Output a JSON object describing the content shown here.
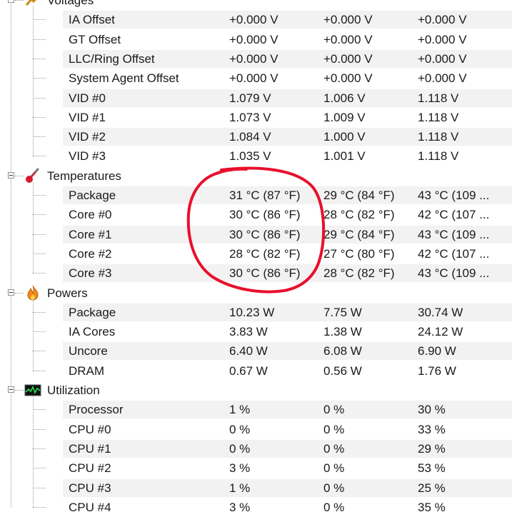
{
  "categories": [
    {
      "key": "voltages",
      "label": "Voltages",
      "icon": "voltage-icon",
      "rows": [
        {
          "name": "IA Offset",
          "v1": "+0.000 V",
          "v2": "+0.000 V",
          "v3": "+0.000 V"
        },
        {
          "name": "GT Offset",
          "v1": "+0.000 V",
          "v2": "+0.000 V",
          "v3": "+0.000 V"
        },
        {
          "name": "LLC/Ring Offset",
          "v1": "+0.000 V",
          "v2": "+0.000 V",
          "v3": "+0.000 V"
        },
        {
          "name": "System Agent Offset",
          "v1": "+0.000 V",
          "v2": "+0.000 V",
          "v3": "+0.000 V"
        },
        {
          "name": "VID #0",
          "v1": "1.079 V",
          "v2": "1.006 V",
          "v3": "1.118 V"
        },
        {
          "name": "VID #1",
          "v1": "1.073 V",
          "v2": "1.009 V",
          "v3": "1.118 V"
        },
        {
          "name": "VID #2",
          "v1": "1.084 V",
          "v2": "1.000 V",
          "v3": "1.118 V"
        },
        {
          "name": "VID #3",
          "v1": "1.035 V",
          "v2": "1.001 V",
          "v3": "1.118 V"
        }
      ]
    },
    {
      "key": "temperatures",
      "label": "Temperatures",
      "icon": "thermometer-icon",
      "rows": [
        {
          "name": "Package",
          "v1": "31 °C  (87 °F)",
          "v2": "29 °C  (84 °F)",
          "v3": "43 °C  (109 ..."
        },
        {
          "name": "Core #0",
          "v1": "30 °C  (86 °F)",
          "v2": "28 °C  (82 °F)",
          "v3": "42 °C  (107 ..."
        },
        {
          "name": "Core #1",
          "v1": "30 °C  (86 °F)",
          "v2": "29 °C  (84 °F)",
          "v3": "43 °C  (109 ..."
        },
        {
          "name": "Core #2",
          "v1": "28 °C  (82 °F)",
          "v2": "27 °C  (80 °F)",
          "v3": "42 °C  (107 ..."
        },
        {
          "name": "Core #3",
          "v1": "30 °C  (86 °F)",
          "v2": "28 °C  (82 °F)",
          "v3": "43 °C  (109 ..."
        }
      ]
    },
    {
      "key": "powers",
      "label": "Powers",
      "icon": "flame-icon",
      "rows": [
        {
          "name": "Package",
          "v1": "10.23 W",
          "v2": "7.75 W",
          "v3": "30.74 W"
        },
        {
          "name": "IA Cores",
          "v1": "3.83 W",
          "v2": "1.38 W",
          "v3": "24.12 W"
        },
        {
          "name": "Uncore",
          "v1": "6.40 W",
          "v2": "6.08 W",
          "v3": "6.90 W"
        },
        {
          "name": "DRAM",
          "v1": "0.67 W",
          "v2": "0.56 W",
          "v3": "1.76 W"
        }
      ]
    },
    {
      "key": "utilization",
      "label": "Utilization",
      "icon": "monitor-graph-icon",
      "rows": [
        {
          "name": "Processor",
          "v1": "1 %",
          "v2": "0 %",
          "v3": "30 %"
        },
        {
          "name": "CPU #0",
          "v1": "0 %",
          "v2": "0 %",
          "v3": "33 %"
        },
        {
          "name": "CPU #1",
          "v1": "0 %",
          "v2": "0 %",
          "v3": "29 %"
        },
        {
          "name": "CPU #2",
          "v1": "3 %",
          "v2": "0 %",
          "v3": "53 %"
        },
        {
          "name": "CPU #3",
          "v1": "1 %",
          "v2": "0 %",
          "v3": "25 %"
        },
        {
          "name": "CPU #4",
          "v1": "3 %",
          "v2": "0 %",
          "v3": "35 %"
        }
      ]
    }
  ],
  "colors": {
    "annotation": "#e8102c",
    "alt_row": "#f2f2f2",
    "tree_lines": "#9a9a9a"
  }
}
